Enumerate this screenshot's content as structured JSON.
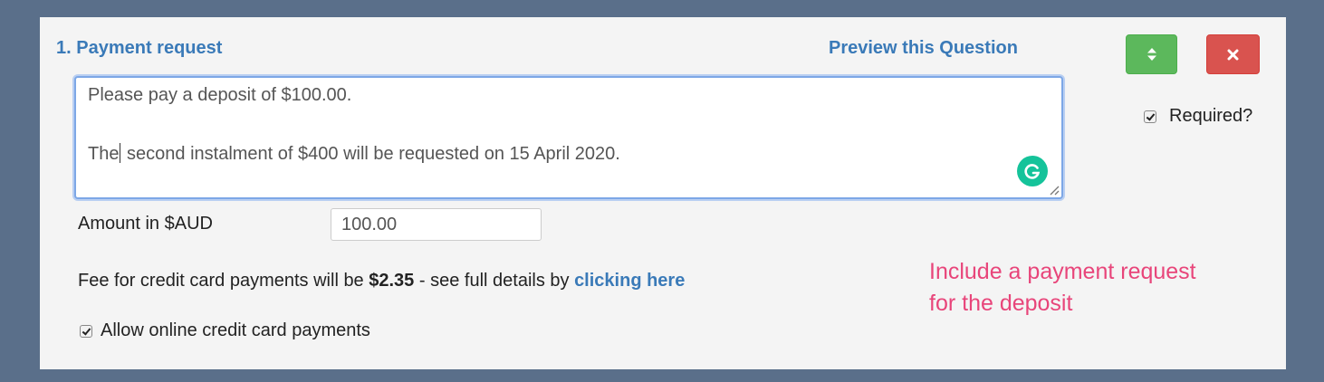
{
  "question": {
    "title": "1. Payment request",
    "preview_label": "Preview this Question",
    "text_line1": "Please pay a deposit of $100.00.",
    "text_line2_before_caret": "The",
    "text_line2_after_caret": " second instalment of $400 will be requested on 15 April 2020.",
    "required_label": "Required?",
    "required_checked": true
  },
  "controls": {
    "move_icon": "sort-arrows-icon",
    "delete_icon": "close-x-icon",
    "move_color": "#5cb85c",
    "delete_color": "#d9534f"
  },
  "amount": {
    "label": "Amount in $AUD",
    "value": "100.00"
  },
  "fee": {
    "prefix": "Fee for credit card payments will be ",
    "amount": "$2.35",
    "middle": " - see full details by ",
    "link_label": "clicking here"
  },
  "allow_online": {
    "label": "Allow online credit card payments",
    "checked": true
  },
  "annotation": {
    "line1": "Include a payment request",
    "line2": "for the deposit",
    "color": "#e8457a"
  },
  "grammarly_icon": "grammarly-icon"
}
